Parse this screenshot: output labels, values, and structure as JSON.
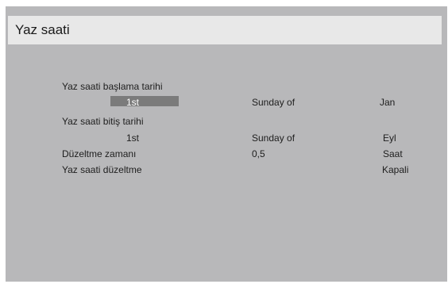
{
  "window": {
    "title": "Yaz saati"
  },
  "rows": {
    "start_label": "Yaz saati başlama tarihi",
    "start_week": "1st",
    "start_day": "Sunday of",
    "start_month": "Jan",
    "end_label": "Yaz saati bitiş tarihi",
    "end_week": "1st",
    "end_day": "Sunday of",
    "end_month": "Eyl",
    "offset_label": "Düzeltme zamanı",
    "offset_value": "0,5",
    "offset_unit": "Saat",
    "dst_label": "Yaz saati düzeltme",
    "dst_value": "Kapali"
  },
  "colors": {
    "panel": "#b8b8ba",
    "titlebar": "#e8e8e8",
    "selection": "#7b7b7b"
  }
}
